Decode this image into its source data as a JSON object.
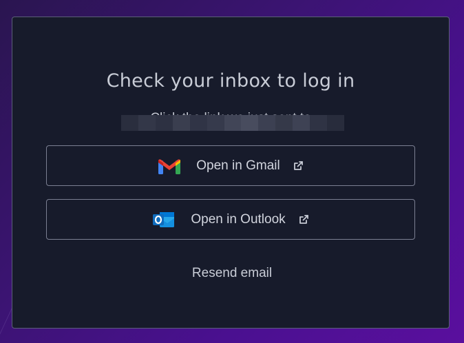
{
  "login": {
    "title": "Check your inbox to log in",
    "subtitle": "Click the link we just sent to",
    "gmail_label": "Open in Gmail",
    "outlook_label": "Open in Outlook",
    "resend_label": "Resend email"
  },
  "icons": {
    "gmail": "gmail-icon",
    "outlook": "outlook-icon",
    "external": "external-link-icon"
  },
  "colors": {
    "card_bg": "#171b2b",
    "card_border": "#5b5f78",
    "text": "#c8ccd6",
    "gmail_red": "#ea4335",
    "gmail_blue": "#4285f4",
    "gmail_green": "#34a853",
    "gmail_yellow": "#fbbc04",
    "outlook_blue": "#0f6cbd"
  }
}
